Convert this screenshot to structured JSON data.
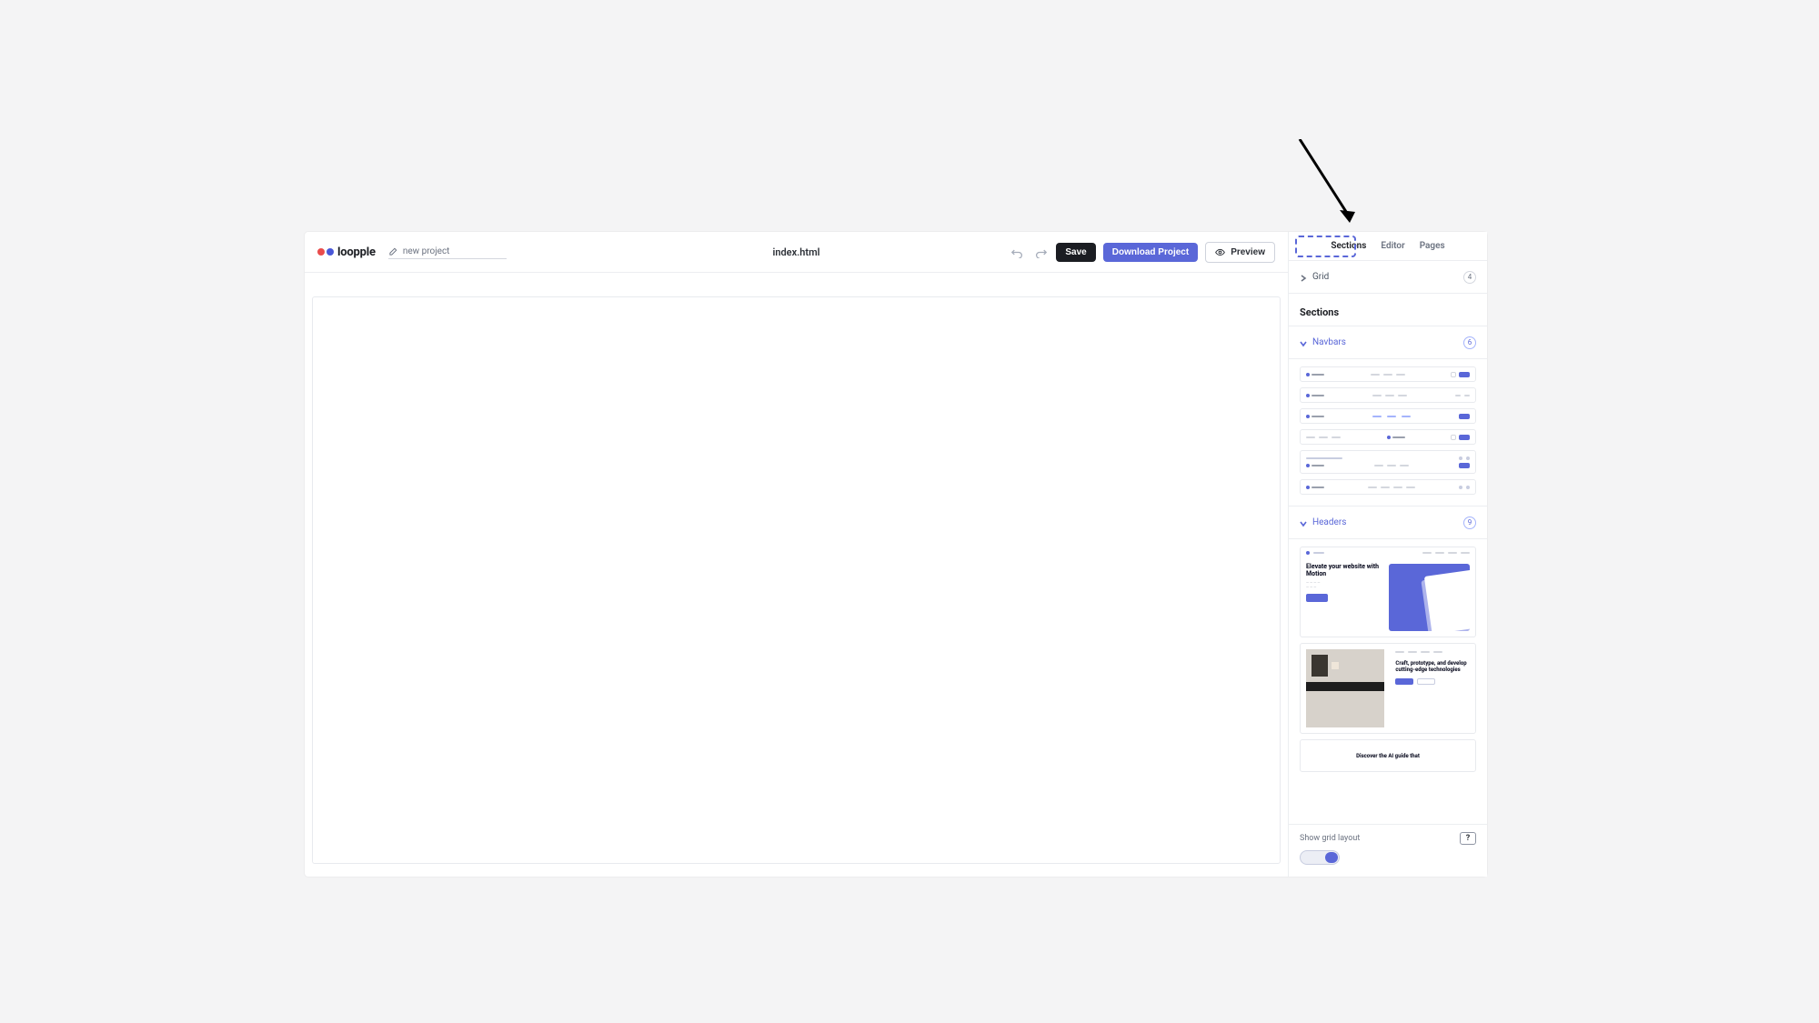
{
  "brand": "loopple",
  "topbar": {
    "project_name": "new project",
    "filename": "index.html",
    "undo": "Undo",
    "redo": "Redo",
    "save": "Save",
    "download": "Download Project",
    "preview": "Preview"
  },
  "right_panel": {
    "tabs": {
      "sections": "Sections",
      "editor": "Editor",
      "pages": "Pages",
      "active": "sections"
    },
    "grid": {
      "label": "Grid",
      "count": "4"
    },
    "sections_title": "Sections",
    "groups": {
      "navbars": {
        "label": "Navbars",
        "count": "6"
      },
      "headers": {
        "label": "Headers",
        "count": "9"
      }
    },
    "header_samples": {
      "h1_title": "Elevate your website with Motion",
      "h2_title": "Craft, prototype, and develop cutting-edge technologies",
      "h3_title": "Discover the AI guide that"
    },
    "footer": {
      "show_grid": "Show grid layout",
      "help": "?"
    }
  },
  "colors": {
    "accent": "#5a67d8",
    "dark": "#1b1d22"
  }
}
